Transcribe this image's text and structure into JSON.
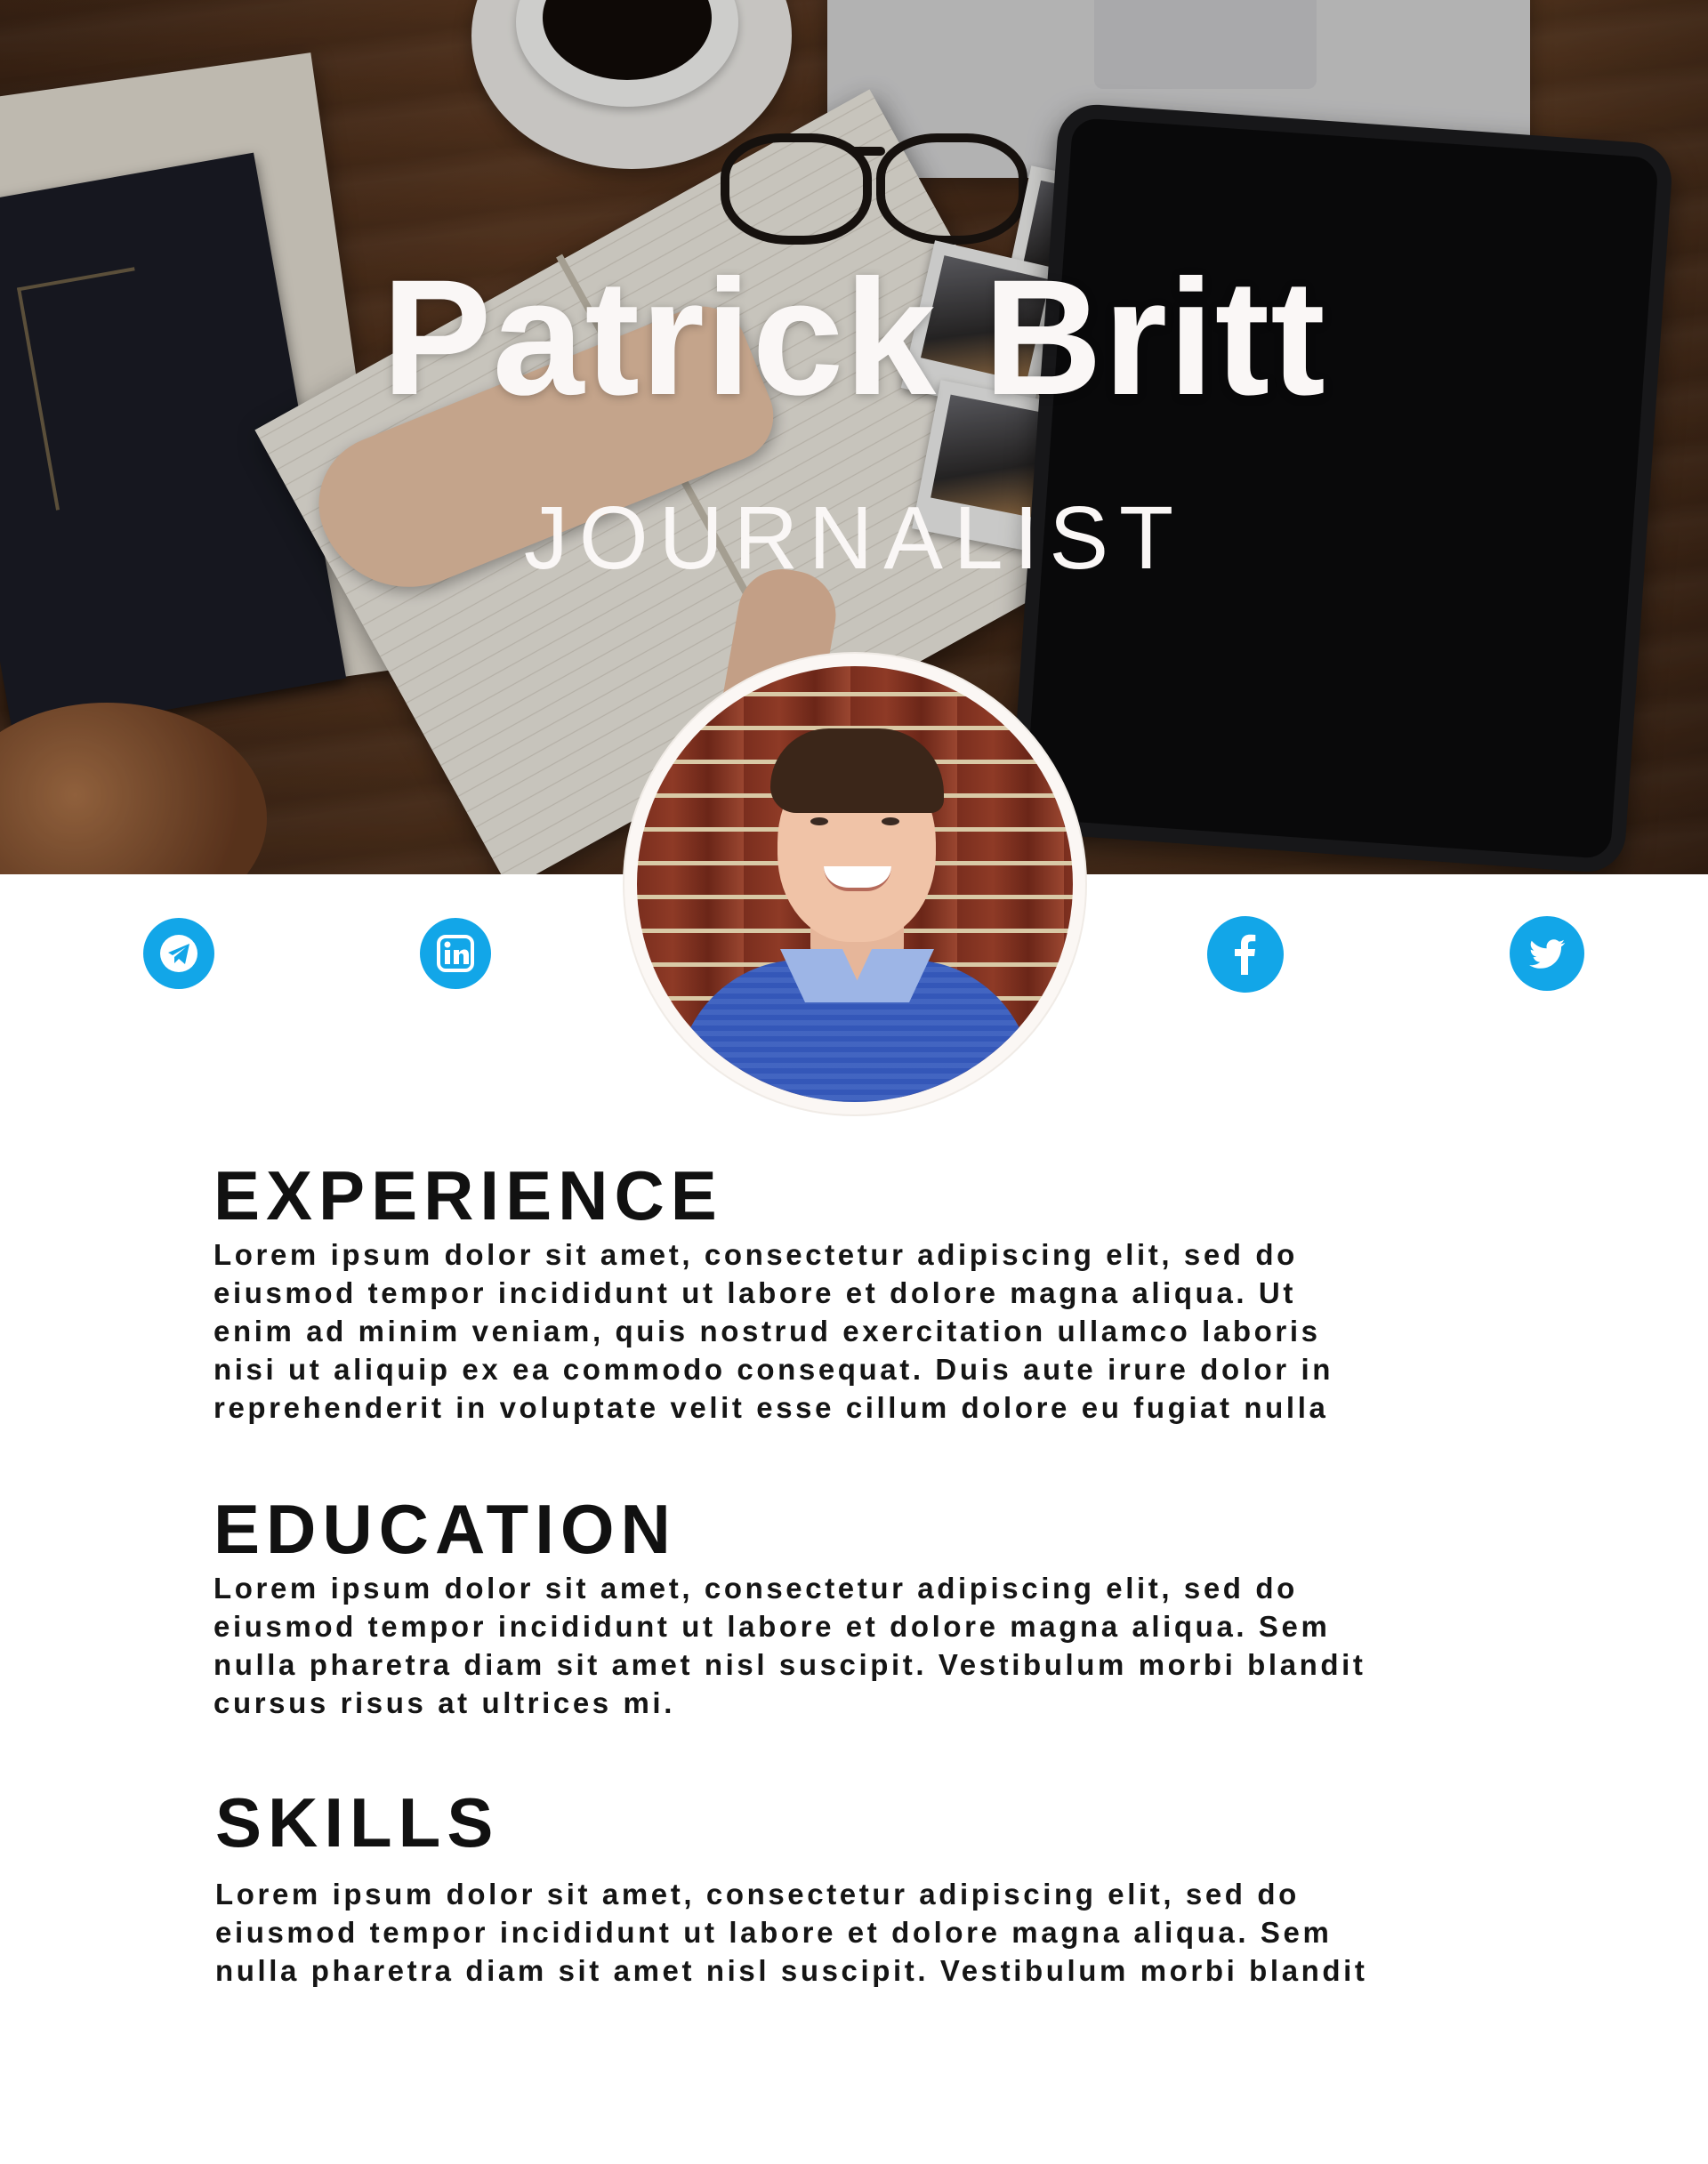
{
  "header": {
    "name": "Patrick Britt",
    "role": "JOURNALIST"
  },
  "social": [
    {
      "icon": "telegram-icon",
      "color": "#12a6e8"
    },
    {
      "icon": "linkedin-icon",
      "color": "#12a6e8"
    },
    {
      "icon": "facebook-icon",
      "color": "#12a6e8"
    },
    {
      "icon": "twitter-icon",
      "color": "#12a6e8"
    }
  ],
  "sections": {
    "experience": {
      "title": "EXPERIENCE",
      "body": "Lorem ipsum dolor sit amet, consectetur adipiscing elit, sed do\neiusmod tempor incididunt ut labore et dolore magna aliqua. Ut\nenim ad minim veniam, quis nostrud exercitation ullamco laboris\nnisi ut aliquip ex ea commodo consequat. Duis aute irure dolor in\nreprehenderit in voluptate velit esse cillum dolore eu fugiat nulla"
    },
    "education": {
      "title": "EDUCATION",
      "body": "Lorem ipsum dolor sit amet, consectetur adipiscing elit, sed do\neiusmod tempor incididunt ut labore et dolore magna aliqua. Sem\nnulla pharetra diam sit amet nisl suscipit. Vestibulum morbi blandit\ncursus risus at ultrices mi."
    },
    "skills": {
      "title": "SKILLS",
      "body": "Lorem ipsum dolor sit amet, consectetur adipiscing elit, sed do\neiusmod tempor incididunt ut labore et dolore magna aliqua. Sem\nnulla pharetra diam sit amet nisl suscipit. Vestibulum morbi blandit"
    }
  },
  "colors": {
    "accent": "#12a6e8",
    "heading": "#111111",
    "hero_text": "#faf7f6"
  }
}
